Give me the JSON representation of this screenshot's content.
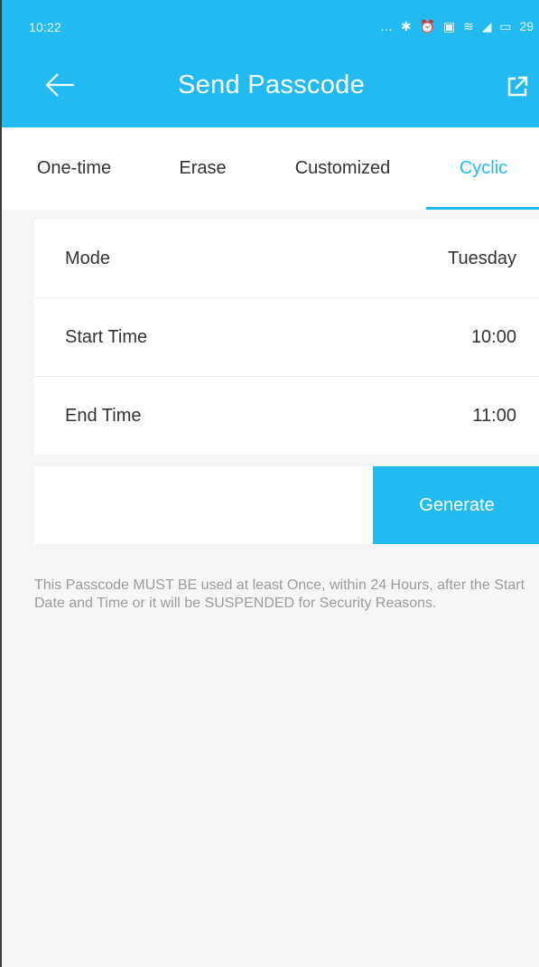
{
  "status_bar": {
    "time": "10:22",
    "icons": [
      "more-icon",
      "bluetooth-icon",
      "alarm-icon",
      "gallery-icon",
      "wifi-icon",
      "signal-icon",
      "battery-icon"
    ],
    "battery_text": "29"
  },
  "header": {
    "title": "Send Passcode",
    "back_icon": "arrow-left-icon",
    "share_icon": "share-icon"
  },
  "tabs": [
    {
      "label": "One-time",
      "active": false
    },
    {
      "label": "Erase",
      "active": false
    },
    {
      "label": "Customized",
      "active": false
    },
    {
      "label": "Cyclic",
      "active": true
    }
  ],
  "settings": {
    "mode": {
      "label": "Mode",
      "value": "Tuesday"
    },
    "start_time": {
      "label": "Start Time",
      "value": "10:00"
    },
    "end_time": {
      "label": "End Time",
      "value": "11:00"
    }
  },
  "generate_label": "Generate",
  "notice": "This Passcode MUST BE used at least Once, within 24 Hours, after the Start Date and Time or it will be SUSPENDED for Security Reasons.",
  "colors": {
    "accent": "#23baf1",
    "text": "#333333",
    "muted": "#9c9c9c",
    "background": "#f6f6f6"
  }
}
